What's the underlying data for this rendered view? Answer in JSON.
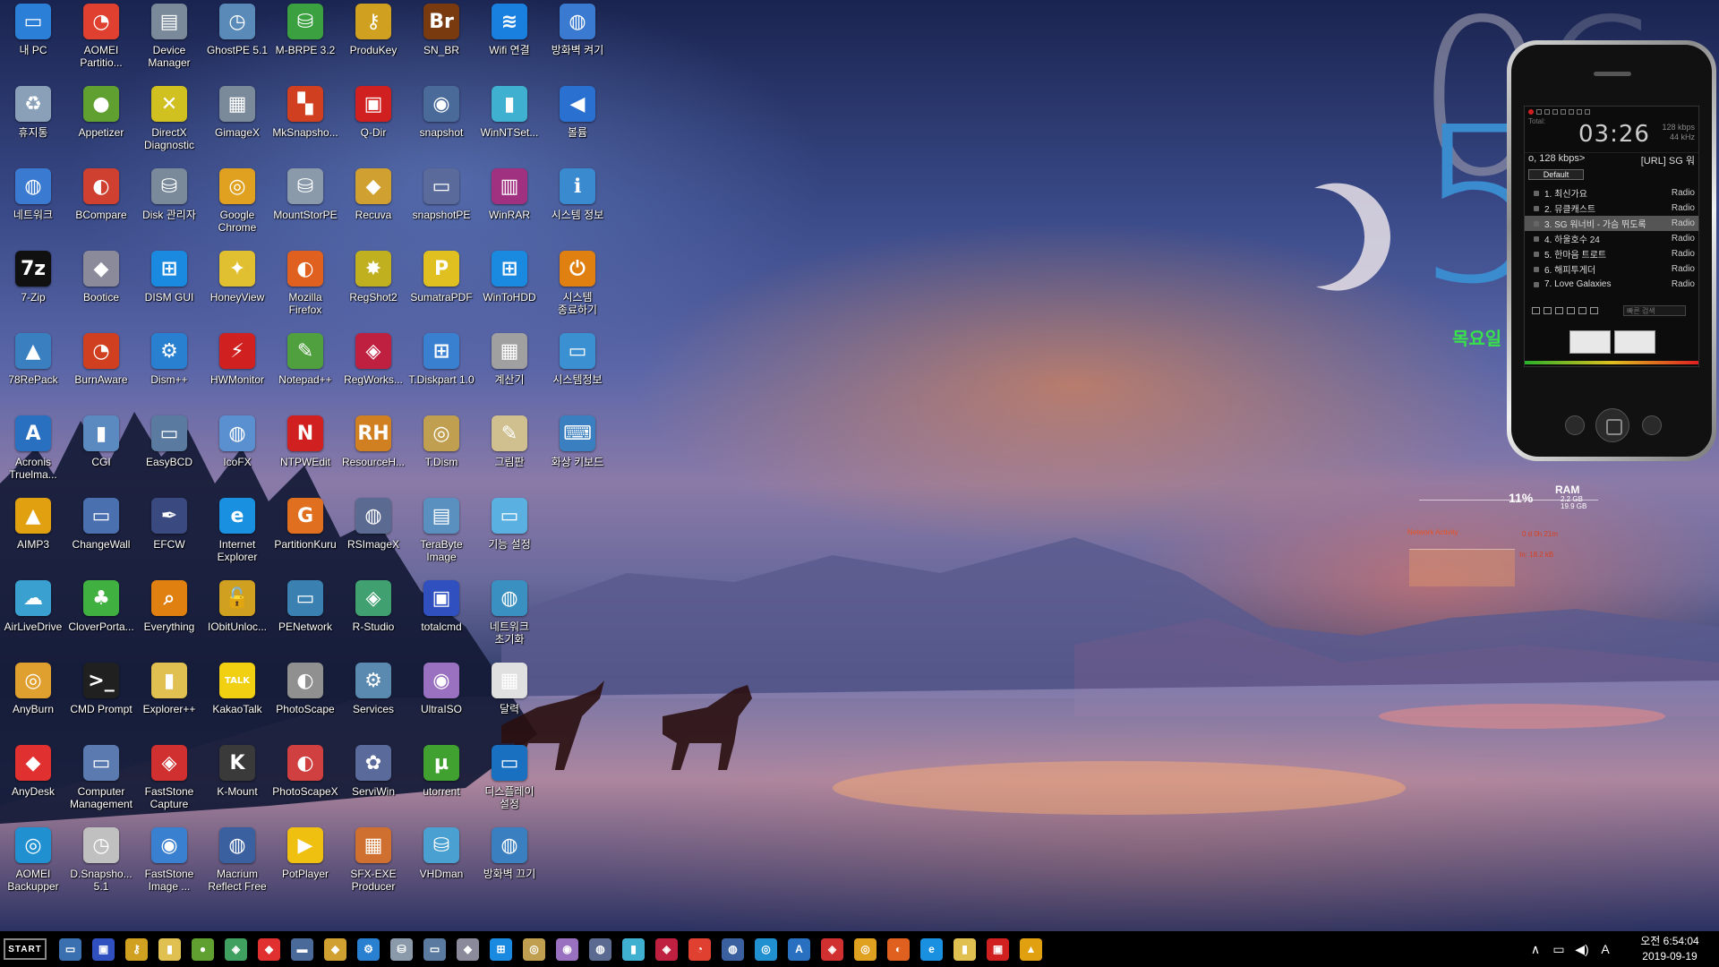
{
  "desktop": {
    "icons": [
      {
        "label": "내 PC",
        "icon": "monitor-icon",
        "color": "#2b7fd6",
        "g": "▭"
      },
      {
        "label": "AOMEI Partitio...",
        "icon": "aomei-partition-icon",
        "color": "#e04030",
        "g": "◔"
      },
      {
        "label": "Device Manager",
        "icon": "device-manager-icon",
        "color": "#7a8a9a",
        "g": "▤"
      },
      {
        "label": "GhostPE 5.1",
        "icon": "ghost-clock-icon",
        "color": "#5a8ab8",
        "g": "◷"
      },
      {
        "label": "M-BRPE 3.2",
        "icon": "drive-icon",
        "color": "#3aa040",
        "g": "⛁"
      },
      {
        "label": "ProduKey",
        "icon": "key-icon",
        "color": "#d0a020",
        "g": "⚷"
      },
      {
        "label": "SN_BR",
        "icon": "bridge-br-icon",
        "color": "#7a3a10",
        "g": "Br"
      },
      {
        "label": "Wifi 연결",
        "icon": "wifi-icon",
        "color": "#1a80e0",
        "g": "≋"
      },
      {
        "label": "방화벽 켜기",
        "icon": "globe-icon",
        "color": "#3a7ad0",
        "g": "◍"
      },
      {
        "label": "휴지통",
        "icon": "recycle-bin-icon",
        "color": "#8aa0b8",
        "g": "♻"
      },
      {
        "label": "Appetizer",
        "icon": "appetizer-icon",
        "color": "#60a030",
        "g": "●"
      },
      {
        "label": "DirectX Diagnostic",
        "icon": "directx-icon",
        "color": "#d0c020",
        "g": "✕"
      },
      {
        "label": "GimageX",
        "icon": "gimagex-icon",
        "color": "#7a8a9a",
        "g": "▦"
      },
      {
        "label": "MkSnapsho...",
        "icon": "snapshot-windows-icon",
        "color": "#d04020",
        "g": "▚"
      },
      {
        "label": "Q-Dir",
        "icon": "qdir-icon",
        "color": "#d02020",
        "g": "▣"
      },
      {
        "label": "snapshot",
        "icon": "camera-icon",
        "color": "#4a6a9a",
        "g": "◉"
      },
      {
        "label": "WinNTSet...",
        "icon": "winntsetup-icon",
        "color": "#40b0d0",
        "g": "▮"
      },
      {
        "label": "볼륨",
        "icon": "speaker-icon",
        "color": "#2a70d0",
        "g": "◀"
      },
      {
        "label": "네트워크",
        "icon": "network-icon",
        "color": "#3a7ad0",
        "g": "◍"
      },
      {
        "label": "BCompare",
        "icon": "bcompare-icon",
        "color": "#d04030",
        "g": "◐"
      },
      {
        "label": "Disk 관리자",
        "icon": "disk-manager-icon",
        "color": "#7a8a9a",
        "g": "⛁"
      },
      {
        "label": "Google Chrome",
        "icon": "chrome-icon",
        "color": "#e0a020",
        "g": "◎"
      },
      {
        "label": "MountStorPE",
        "icon": "mount-icon",
        "color": "#8a9aaa",
        "g": "⛁"
      },
      {
        "label": "Recuva",
        "icon": "recuva-icon",
        "color": "#d0a030",
        "g": "◆"
      },
      {
        "label": "snapshotPE",
        "icon": "snapshotpe-icon",
        "color": "#5a6a9a",
        "g": "▭"
      },
      {
        "label": "WinRAR",
        "icon": "winrar-icon",
        "color": "#a03080",
        "g": "▥"
      },
      {
        "label": "시스템 정보",
        "icon": "system-info-icon",
        "color": "#3a8ad0",
        "g": "ℹ"
      },
      {
        "label": "7-Zip",
        "icon": "7zip-icon",
        "color": "#101010",
        "g": "7z"
      },
      {
        "label": "Bootice",
        "icon": "bootice-icon",
        "color": "#8a8a9a",
        "g": "◆"
      },
      {
        "label": "DISM GUI",
        "icon": "windows-logo-icon",
        "color": "#1a8ae0",
        "g": "⊞"
      },
      {
        "label": "HoneyView",
        "icon": "honeyview-icon",
        "color": "#e0c030",
        "g": "✦"
      },
      {
        "label": "Mozilla Firefox",
        "icon": "firefox-icon",
        "color": "#e06020",
        "g": "◐"
      },
      {
        "label": "RegShot2",
        "icon": "regshot-icon",
        "color": "#c0b020",
        "g": "✸"
      },
      {
        "label": "SumatraPDF",
        "icon": "pdf-icon",
        "color": "#e0c020",
        "g": "P"
      },
      {
        "label": "WinToHDD",
        "icon": "wintohdd-icon",
        "color": "#1a8ae0",
        "g": "⊞"
      },
      {
        "label": "시스템 종료하기",
        "icon": "power-icon",
        "color": "#e08010",
        "g": "⏻"
      },
      {
        "label": "78RePack",
        "icon": "78repack-icon",
        "color": "#3a80c0",
        "g": "▲"
      },
      {
        "label": "BurnAware",
        "icon": "burnaware-icon",
        "color": "#d04020",
        "g": "◔"
      },
      {
        "label": "Dism++",
        "icon": "gear-icon",
        "color": "#2a80d0",
        "g": "⚙"
      },
      {
        "label": "HWMonitor",
        "icon": "hwmonitor-icon",
        "color": "#d02020",
        "g": "⚡"
      },
      {
        "label": "Notepad++",
        "icon": "notepadpp-icon",
        "color": "#50a040",
        "g": "✎"
      },
      {
        "label": "RegWorks...",
        "icon": "regworks-icon",
        "color": "#c02040",
        "g": "◈"
      },
      {
        "label": "T.Diskpart 1.0",
        "icon": "diskpart-icon",
        "color": "#3a80d0",
        "g": "⊞"
      },
      {
        "label": "계산기",
        "icon": "calculator-icon",
        "color": "#a0a0a0",
        "g": "▦"
      },
      {
        "label": "시스템정보",
        "icon": "system-info-monitor-icon",
        "color": "#3a90d0",
        "g": "▭"
      },
      {
        "label": "Acronis Truelma...",
        "icon": "acronis-icon",
        "color": "#2a70c0",
        "g": "A"
      },
      {
        "label": "CGI",
        "icon": "cgi-icon",
        "color": "#5a8ac0",
        "g": "▮"
      },
      {
        "label": "EasyBCD",
        "icon": "easybcd-icon",
        "color": "#5a7aa0",
        "g": "▭"
      },
      {
        "label": "IcoFX",
        "icon": "icofx-icon",
        "color": "#5a90d0",
        "g": "◍"
      },
      {
        "label": "NTPWEdit",
        "icon": "ntpwedit-icon",
        "color": "#d02020",
        "g": "N"
      },
      {
        "label": "ResourceH...",
        "icon": "resourcehacker-icon",
        "color": "#d08020",
        "g": "RH"
      },
      {
        "label": "T.Dism",
        "icon": "tdism-icon",
        "color": "#c0a050",
        "g": "◎"
      },
      {
        "label": "그림판",
        "icon": "paint-icon",
        "color": "#d0c090",
        "g": "✎"
      },
      {
        "label": "화상 키보드",
        "icon": "keyboard-icon",
        "color": "#3a80c0",
        "g": "⌨"
      },
      {
        "label": "AIMP3",
        "icon": "aimp-icon",
        "color": "#e0a010",
        "g": "▲"
      },
      {
        "label": "ChangeWall",
        "icon": "changewall-icon",
        "color": "#4a70b0",
        "g": "▭"
      },
      {
        "label": "EFCW",
        "icon": "efcw-icon",
        "color": "#3a4a80",
        "g": "✒"
      },
      {
        "label": "Internet Explorer",
        "icon": "internet-explorer-icon",
        "color": "#1a90e0",
        "g": "e"
      },
      {
        "label": "PartitionKuru",
        "icon": "partitionkuru-icon",
        "color": "#e07020",
        "g": "G"
      },
      {
        "label": "RSImageX",
        "icon": "rsimagex-icon",
        "color": "#5a6a90",
        "g": "◍"
      },
      {
        "label": "TeraByte Image",
        "icon": "terabyte-icon",
        "color": "#5a90c0",
        "g": "▤"
      },
      {
        "label": "기능 설정",
        "icon": "settings-panel-icon",
        "color": "#5ab0e0",
        "g": "▭"
      },
      {
        "label": "AirLiveDrive",
        "icon": "airlivedrive-icon",
        "color": "#3aa0d0",
        "g": "☁"
      },
      {
        "label": "CloverPorta...",
        "icon": "clover-icon",
        "color": "#40b040",
        "g": "♣"
      },
      {
        "label": "Everything",
        "icon": "magnifier-icon",
        "color": "#e08010",
        "g": "⌕"
      },
      {
        "label": "IObitUnloc...",
        "icon": "lock-icon",
        "color": "#d0a020",
        "g": "🔓"
      },
      {
        "label": "PENetwork",
        "icon": "penetwork-icon",
        "color": "#3a80b0",
        "g": "▭"
      },
      {
        "label": "R-Studio",
        "icon": "rstudio-icon",
        "color": "#40a070",
        "g": "◈"
      },
      {
        "label": "totalcmd",
        "icon": "floppy-icon",
        "color": "#3050c0",
        "g": "▣"
      },
      {
        "label": "네트워크 초기화",
        "icon": "network-reset-icon",
        "color": "#3a90c0",
        "g": "◍"
      },
      {
        "label": "AnyBurn",
        "icon": "anyburn-icon",
        "color": "#e0a030",
        "g": "◎"
      },
      {
        "label": "CMD Prompt",
        "icon": "cmd-icon",
        "color": "#202020",
        "g": ">_"
      },
      {
        "label": "Explorer++",
        "icon": "folder-icon",
        "color": "#e0c050",
        "g": "▮"
      },
      {
        "label": "KakaoTalk",
        "icon": "kakaotalk-icon",
        "color": "#f0d010",
        "g": "TALK"
      },
      {
        "label": "PhotoScape",
        "icon": "photoscape-icon",
        "color": "#909090",
        "g": "◐"
      },
      {
        "label": "Services",
        "icon": "services-gear-icon",
        "color": "#5a8ab0",
        "g": "⚙"
      },
      {
        "label": "UltraISO",
        "icon": "ultraiso-icon",
        "color": "#9a70c0",
        "g": "◉"
      },
      {
        "label": "달력",
        "icon": "calendar-icon",
        "color": "#e0e0e0",
        "g": "▦"
      },
      {
        "label": "AnyDesk",
        "icon": "anydesk-icon",
        "color": "#e03030",
        "g": "◆"
      },
      {
        "label": "Computer Management",
        "icon": "computer-management-icon",
        "color": "#5a7ab0",
        "g": "▭"
      },
      {
        "label": "FastStone Capture",
        "icon": "faststone-capture-icon",
        "color": "#d03030",
        "g": "◈"
      },
      {
        "label": "K-Mount",
        "icon": "kmount-icon",
        "color": "#3a3a3a",
        "g": "K"
      },
      {
        "label": "PhotoScapeX",
        "icon": "photoscapex-icon",
        "color": "#d04040",
        "g": "◐"
      },
      {
        "label": "ServiWin",
        "icon": "serviwin-icon",
        "color": "#5a6a9a",
        "g": "✿"
      },
      {
        "label": "utorrent",
        "icon": "utorrent-icon",
        "color": "#40a030",
        "g": "µ"
      },
      {
        "label": "디스플레이 설정",
        "icon": "display-settings-icon",
        "color": "#1a70c0",
        "g": "▭"
      },
      {
        "label": "AOMEI Backupper",
        "icon": "aomei-backupper-icon",
        "color": "#2090d0",
        "g": "◎"
      },
      {
        "label": "D.Snapsho... 5.1",
        "icon": "dsnapshot-icon",
        "color": "#c0c0c0",
        "g": "◷"
      },
      {
        "label": "FastStone Image ...",
        "icon": "faststone-image-icon",
        "color": "#3a80d0",
        "g": "◉"
      },
      {
        "label": "Macrium Reflect Free",
        "icon": "macrium-icon",
        "color": "#3a60a0",
        "g": "◍"
      },
      {
        "label": "PotPlayer",
        "icon": "potplayer-icon",
        "color": "#f0c010",
        "g": "▶"
      },
      {
        "label": "SFX-EXE Producer",
        "icon": "sfx-box-icon",
        "color": "#d07030",
        "g": "▦"
      },
      {
        "label": "VHDman",
        "icon": "vhdman-icon",
        "color": "#4aa0d0",
        "g": "⛁"
      },
      {
        "label": "방화벽 끄기",
        "icon": "firewall-off-globe-icon",
        "color": "#3a80c0",
        "g": "◍"
      }
    ]
  },
  "clock_widget": {
    "hour_digit": "0",
    "hour_digit2": "6",
    "minute_digit": "5",
    "weekday": "목요일",
    "accent_color": "#3a8ccf"
  },
  "player": {
    "total_label": "Total:",
    "time": "03:26",
    "bitrate": "128 kbps",
    "samplerate": "44 kHz",
    "stream_left": "o, 128 kbps>",
    "stream_right": "[URL] SG 워",
    "playlist_tab": "Default",
    "playlist": [
      {
        "title": "1. 최신가요",
        "kind": "Radio"
      },
      {
        "title": "2. 뮤클캐스트",
        "kind": "Radio"
      },
      {
        "title": "3. SG 워너비 - 가슴 뛰도록",
        "kind": "Radio"
      },
      {
        "title": "4. 하울호수 24",
        "kind": "Radio"
      },
      {
        "title": "5. 한마음 트로트",
        "kind": "Radio"
      },
      {
        "title": "6. 해피투게더",
        "kind": "Radio"
      },
      {
        "title": "7. Love Galaxies",
        "kind": "Radio"
      }
    ],
    "active_index": 2,
    "search_placeholder": "빠른 검색"
  },
  "sysmon": {
    "cpu_percent": "11%",
    "ram_label": "RAM",
    "ram_used": "2.2 GB",
    "ram_total": "19.9 GB",
    "network_title": "Network Activity",
    "uptime": "0 d 0h 21m",
    "net_in": "In: 18.2 kB"
  },
  "taskbar": {
    "start_label": "START",
    "items": [
      {
        "icon": "computer-taskbar-icon",
        "color": "#3a70b0",
        "g": "▭"
      },
      {
        "icon": "floppy-taskbar-icon",
        "color": "#3050c0",
        "g": "▣"
      },
      {
        "icon": "key-taskbar-icon",
        "color": "#d0a020",
        "g": "⚷"
      },
      {
        "icon": "folder-taskbar-icon",
        "color": "#e0c050",
        "g": "▮"
      },
      {
        "icon": "appetizer-taskbar-icon",
        "color": "#60a030",
        "g": "●"
      },
      {
        "icon": "green-app-taskbar-icon",
        "color": "#40a060",
        "g": "◈"
      },
      {
        "icon": "anydesk-taskbar-icon",
        "color": "#e03030",
        "g": "◆"
      },
      {
        "icon": "drive-taskbar-icon",
        "color": "#4a6a9a",
        "g": "▬"
      },
      {
        "icon": "recuva-taskbar-icon",
        "color": "#d0a030",
        "g": "◆"
      },
      {
        "icon": "gear-taskbar-icon",
        "color": "#2a80d0",
        "g": "⚙"
      },
      {
        "icon": "disk-taskbar-icon",
        "color": "#8a9aaa",
        "g": "⛁"
      },
      {
        "icon": "easybcd-taskbar-icon",
        "color": "#5a7aa0",
        "g": "▭"
      },
      {
        "icon": "bootice-taskbar-icon",
        "color": "#8a8a9a",
        "g": "◆"
      },
      {
        "icon": "windows-taskbar-icon",
        "color": "#1a8ae0",
        "g": "⊞"
      },
      {
        "icon": "tdism-taskbar-icon",
        "color": "#c0a050",
        "g": "◎"
      },
      {
        "icon": "ultraiso-taskbar-icon",
        "color": "#9a70c0",
        "g": "◉"
      },
      {
        "icon": "rsimagex-taskbar-icon",
        "color": "#5a6a90",
        "g": "◍"
      },
      {
        "icon": "winntsetup-taskbar-icon",
        "color": "#40b0d0",
        "g": "▮"
      },
      {
        "icon": "regworks-taskbar-icon",
        "color": "#c02040",
        "g": "◈"
      },
      {
        "icon": "aomei-taskbar-icon",
        "color": "#e04030",
        "g": "◔"
      },
      {
        "icon": "macrium-taskbar-icon",
        "color": "#3a60a0",
        "g": "◍"
      },
      {
        "icon": "aomei-backupper-taskbar-icon",
        "color": "#2090d0",
        "g": "◎"
      },
      {
        "icon": "acronis-taskbar-icon",
        "color": "#2a70c0",
        "g": "A"
      },
      {
        "icon": "faststone-taskbar-icon",
        "color": "#d03030",
        "g": "◈"
      },
      {
        "icon": "chrome-taskbar-icon",
        "color": "#e0a020",
        "g": "◎"
      },
      {
        "icon": "firefox-taskbar-icon",
        "color": "#e06020",
        "g": "◐"
      },
      {
        "icon": "ie-taskbar-icon",
        "color": "#1a90e0",
        "g": "e"
      },
      {
        "icon": "explorer-taskbar-icon",
        "color": "#e0c050",
        "g": "▮"
      },
      {
        "icon": "qdir-taskbar-icon",
        "color": "#d02020",
        "g": "▣"
      },
      {
        "icon": "aimp-taskbar-icon",
        "color": "#e0a010",
        "g": "▲"
      }
    ],
    "tray": {
      "chevron": "∧",
      "network": "▭",
      "volume": "◀)",
      "ime": "A",
      "time": "오전 6:54:04",
      "date": "2019-09-19"
    }
  }
}
